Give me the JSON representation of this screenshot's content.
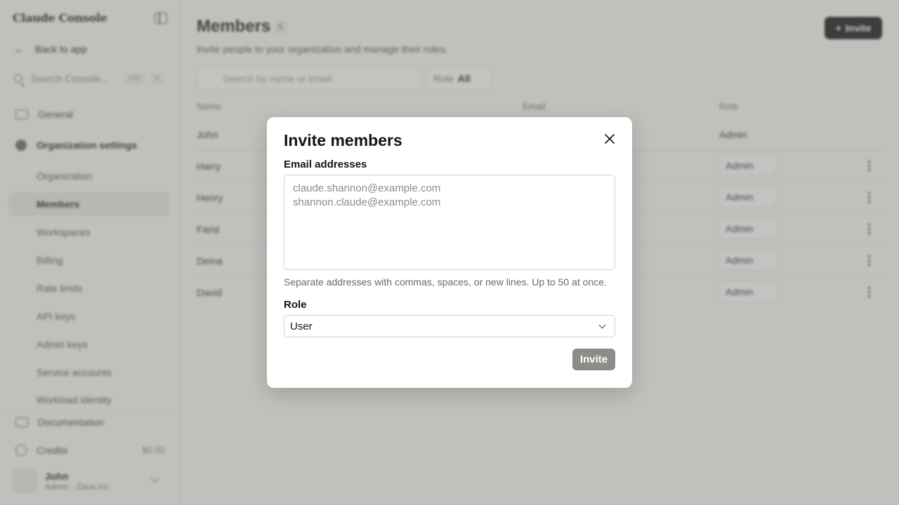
{
  "sidebar": {
    "brand": "Claude Console",
    "back_label": "Back to app",
    "search_placeholder": "Search Console...",
    "search_kbd_1": "Ctrl",
    "search_kbd_2": "K",
    "general": "General",
    "org_settings": "Organization settings",
    "sub_items": [
      "Organization",
      "Members",
      "Workspaces",
      "Billing",
      "Rate limits",
      "API keys",
      "Admin keys",
      "Service accounts",
      "Workload identity"
    ],
    "documentation": "Documentation",
    "credits_label": "Credits",
    "credits_value": "$0.00",
    "user_name": "John",
    "user_role": "Admin",
    "user_org": "Zava Inc"
  },
  "main": {
    "title": "Members",
    "count": "6",
    "subtitle": "Invite people to your organization and manage their roles.",
    "invite_button": "Invite",
    "search_placeholder": "Search by name or email",
    "role_filter_label": "Role",
    "role_filter_value": "All",
    "columns": {
      "name": "Name",
      "email": "Email",
      "role": "Role"
    },
    "rows": [
      {
        "name": "John",
        "role": "Admin"
      },
      {
        "name": "Harry",
        "role": "Admin"
      },
      {
        "name": "Henry",
        "role": "Admin"
      },
      {
        "name": "Farid",
        "role": "Admin"
      },
      {
        "name": "Deina",
        "role": "Admin"
      },
      {
        "name": "David",
        "role": "Admin"
      }
    ]
  },
  "modal": {
    "title": "Invite members",
    "email_label": "Email addresses",
    "email_placeholder": "claude.shannon@example.com\nshannon.claude@example.com",
    "help_text": "Separate addresses with commas, spaces, or new lines. Up to 50 at once.",
    "role_label": "Role",
    "role_value": "User",
    "invite_label": "Invite"
  }
}
